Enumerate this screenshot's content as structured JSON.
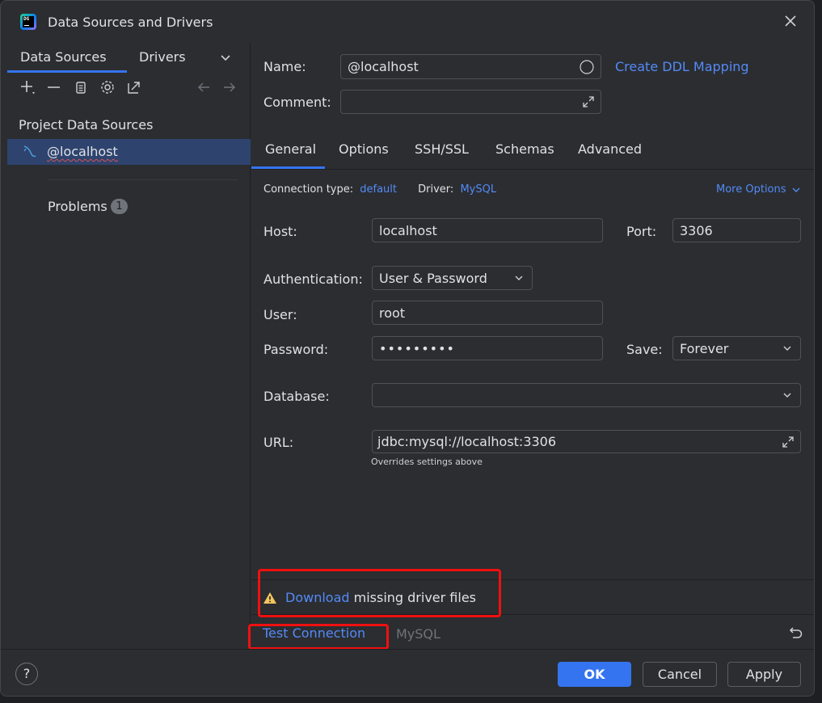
{
  "window": {
    "title": "Data Sources and Drivers",
    "app_icon_text": "DG"
  },
  "left_panel": {
    "tabs": [
      {
        "label": "Data Sources",
        "active": true
      },
      {
        "label": "Drivers",
        "active": false
      }
    ],
    "section_title": "Project Data Sources",
    "data_sources": [
      {
        "label": "@localhost",
        "selected": true
      }
    ],
    "problems": {
      "label": "Problems",
      "count": "1"
    }
  },
  "form": {
    "name_label": "Name:",
    "name_value": "@localhost",
    "create_ddl_link": "Create DDL Mapping",
    "comment_label": "Comment:",
    "comment_value": "",
    "tabs": [
      {
        "label": "General",
        "active": true
      },
      {
        "label": "Options",
        "active": false
      },
      {
        "label": "SSH/SSL",
        "active": false
      },
      {
        "label": "Schemas",
        "active": false
      },
      {
        "label": "Advanced",
        "active": false
      }
    ],
    "connection_type_label": "Connection type:",
    "connection_type_value": "default",
    "driver_label": "Driver:",
    "driver_value": "MySQL",
    "more_options": "More Options",
    "host_label": "Host:",
    "host_value": "localhost",
    "port_label": "Port:",
    "port_value": "3306",
    "auth_label": "Authentication:",
    "auth_value": "User & Password",
    "user_label": "User:",
    "user_value": "root",
    "password_label": "Password:",
    "password_value": "•••••••••",
    "save_label": "Save:",
    "save_value": "Forever",
    "database_label": "Database:",
    "database_value": "",
    "url_label": "URL:",
    "url_value": "jdbc:mysql://localhost:3306",
    "url_hint": "Overrides settings above"
  },
  "warning": {
    "link": "Download",
    "text": " missing driver files"
  },
  "test": {
    "link": "Test Connection",
    "driver": "MySQL"
  },
  "footer": {
    "help": "?",
    "ok": "OK",
    "cancel": "Cancel",
    "apply": "Apply"
  },
  "colors": {
    "accent": "#3574f0",
    "link": "#548af7",
    "highlight_box": "#f01010",
    "selection": "#2e436e"
  }
}
